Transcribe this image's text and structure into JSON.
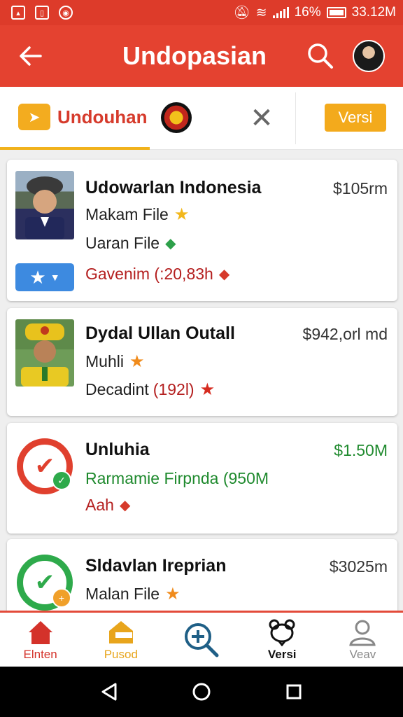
{
  "status_bar": {
    "battery_text": "16%",
    "time": "33.12M",
    "icons": [
      "app-notification-icon",
      "sim-icon",
      "sync-icon",
      "mute-icon",
      "wifi-icon",
      "signal-icon",
      "battery-icon"
    ]
  },
  "app_bar": {
    "title": "Undopasian",
    "back_icon": "arrow-left-icon",
    "search_icon": "search-icon"
  },
  "tabs": {
    "active_label": "Undouhan",
    "action_label": "Versi"
  },
  "items": [
    {
      "title": "Udowarlan Indonesia",
      "line1": "Makam File",
      "line2": "Uaran File",
      "line3": "Gavenim (:20,83h",
      "price": "$105rm"
    },
    {
      "title": "Dydal Ullan Outall",
      "line1": "Muhli",
      "line2": "Decadint",
      "line2_extra": "(192l)",
      "price": "$942,orl md"
    },
    {
      "title": "Unluhia",
      "line1": "Rarmamie Firpnda (950M",
      "line2": "Aah",
      "price": "$1.50M"
    },
    {
      "title": "Sldavlan Ireprian",
      "line1": "Malan File",
      "price": "$3025m"
    }
  ],
  "bottom_nav": [
    {
      "label": "Elnten",
      "icon": "home-icon",
      "color": "#d4322a"
    },
    {
      "label": "Pusod",
      "icon": "upload-home-icon",
      "color": "#e8a51c"
    },
    {
      "label": "",
      "icon": "zoom-in-icon",
      "color": "#1f5f86"
    },
    {
      "label": "Versi",
      "icon": "bear-icon",
      "color": "#111111"
    },
    {
      "label": "Veav",
      "icon": "person-icon",
      "color": "#888888"
    }
  ],
  "colors": {
    "primary": "#e44230",
    "accent": "#f3aa1c",
    "green": "#1f8a2e"
  }
}
